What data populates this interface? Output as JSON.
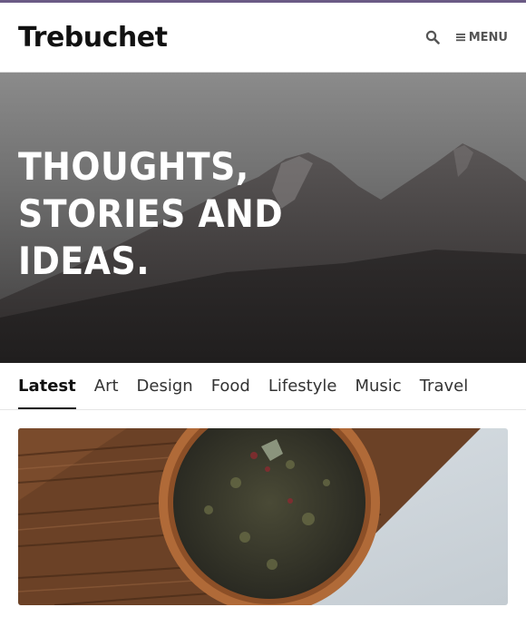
{
  "header": {
    "logo": "Trebuchet",
    "menu_label": "MENU",
    "icons": [
      "search-icon",
      "hamburger-icon"
    ]
  },
  "hero": {
    "title_lines": [
      "THOUGHTS,",
      "STORIES AND",
      "IDEAS."
    ]
  },
  "tabs": [
    {
      "label": "Latest",
      "active": true
    },
    {
      "label": "Art"
    },
    {
      "label": "Design"
    },
    {
      "label": "Food"
    },
    {
      "label": "Lifestyle"
    },
    {
      "label": "Music"
    },
    {
      "label": "Travel"
    }
  ],
  "colors": {
    "top_bar": "#6b5b85",
    "text": "#222222",
    "hero_text": "#ffffff"
  }
}
